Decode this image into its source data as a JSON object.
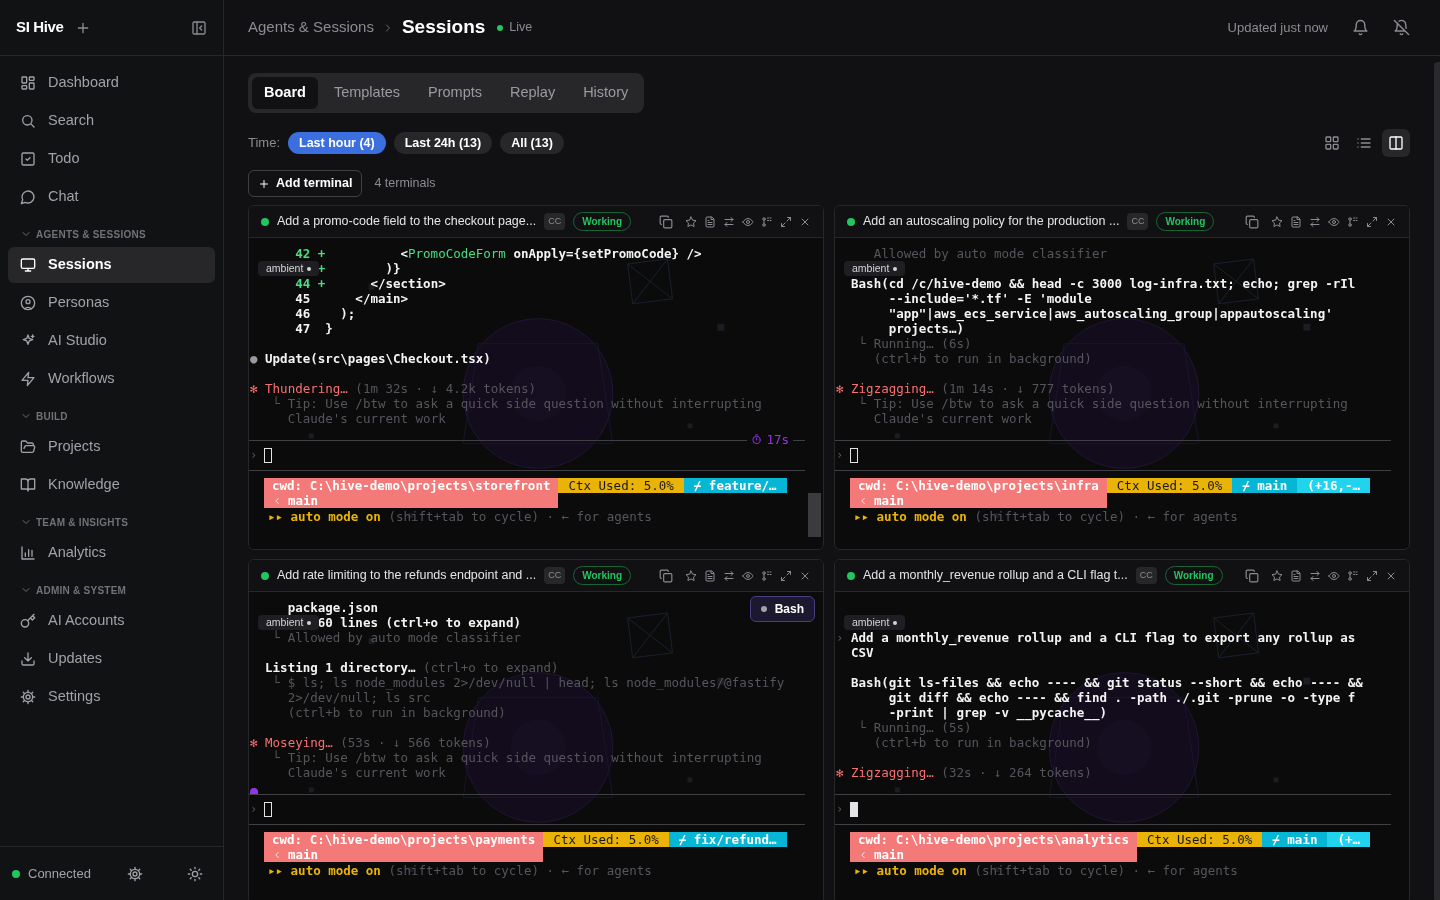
{
  "sidebar": {
    "brand": "SI Hive",
    "groups": [
      {
        "items": [
          {
            "label": "Dashboard",
            "selected": false
          },
          {
            "label": "Search",
            "selected": false
          },
          {
            "label": "Todo",
            "selected": false
          },
          {
            "label": "Chat",
            "selected": false
          }
        ]
      },
      {
        "label": "AGENTS & SESSIONS",
        "expanded": true,
        "items": [
          {
            "label": "Sessions",
            "selected": true
          },
          {
            "label": "Personas",
            "selected": false
          },
          {
            "label": "AI Studio",
            "selected": false
          },
          {
            "label": "Workflows",
            "selected": false
          }
        ]
      },
      {
        "label": "BUILD",
        "expanded": true,
        "items": [
          {
            "label": "Projects",
            "selected": false
          },
          {
            "label": "Knowledge",
            "selected": false
          }
        ]
      },
      {
        "label": "TEAM & INSIGHTS",
        "expanded": true,
        "items": [
          {
            "label": "Analytics",
            "selected": false
          }
        ]
      },
      {
        "label": "ADMIN & SYSTEM",
        "expanded": true,
        "items": [
          {
            "label": "AI Accounts",
            "selected": false
          },
          {
            "label": "Updates",
            "selected": false
          },
          {
            "label": "Settings",
            "selected": false
          }
        ]
      }
    ],
    "footer": {
      "status": "Connected",
      "online": true
    }
  },
  "header": {
    "parent": "Agents & Sessions",
    "title": "Sessions",
    "live": "Live",
    "updated": "Updated just now"
  },
  "tabs": [
    {
      "label": "Board",
      "selected": true
    },
    {
      "label": "Templates",
      "selected": false
    },
    {
      "label": "Prompts",
      "selected": false
    },
    {
      "label": "Replay",
      "selected": false
    },
    {
      "label": "History",
      "selected": false
    }
  ],
  "time_filter": {
    "label": "Time:",
    "options": [
      {
        "label": "Last hour (4)",
        "selected": true
      },
      {
        "label": "Last 24h (13)",
        "selected": false
      },
      {
        "label": "All (13)",
        "selected": false
      }
    ]
  },
  "view_modes": [
    {
      "kind": "grid",
      "selected": false
    },
    {
      "kind": "list",
      "selected": false
    },
    {
      "kind": "columns",
      "selected": true
    }
  ],
  "add_terminal": "Add terminal",
  "terminal_count": "4 terminals",
  "terminals": [
    {
      "title": "Add a promo-code field to the checkout page...",
      "agent": "CC",
      "status": "Working",
      "active": true,
      "ambient": "ambient",
      "prompt": "›",
      "focused": false,
      "scrollbar": true,
      "timer": "17s",
      "lines": [
        {
          "kind": "text",
          "parts": [
            {
              "kind": "add",
              "text": "      42 +          "
            },
            {
              "kind": "bright",
              "text": "<"
            },
            {
              "kind": "tag",
              "text": "PromoCodeForm"
            },
            {
              "kind": "bright",
              "text": " onApply={setPromoCode} />"
            }
          ]
        },
        {
          "kind": "text",
          "parts": [
            {
              "kind": "add",
              "text": "         +        "
            },
            {
              "kind": "bright",
              "text": ")}"
            }
          ]
        },
        {
          "kind": "text",
          "parts": [
            {
              "kind": "add",
              "text": "      44 +      "
            },
            {
              "kind": "bright",
              "text": "</section>"
            }
          ]
        },
        {
          "kind": "text",
          "parts": [
            {
              "kind": "bright",
              "text": "      45      </main>"
            }
          ]
        },
        {
          "kind": "text",
          "parts": [
            {
              "kind": "bright",
              "text": "      46    );"
            }
          ]
        },
        {
          "kind": "text",
          "parts": [
            {
              "kind": "bright",
              "text": "      47  }"
            }
          ]
        },
        {
          "kind": "blank"
        },
        {
          "kind": "text",
          "parts": [
            {
              "kind": "bullet",
              "text": "● "
            },
            {
              "kind": "bright",
              "text": "Update(src\\pages\\Checkout.tsx)"
            }
          ]
        },
        {
          "kind": "blank"
        },
        {
          "kind": "text",
          "parts": [
            {
              "kind": "alert",
              "text": "✻ Thundering…"
            },
            {
              "kind": "dim",
              "text": " (1m 32s · ↓ 4.2k tokens)"
            }
          ]
        },
        {
          "kind": "text",
          "parts": [
            {
              "kind": "dim",
              "text": "   └ Tip: Use /btw to ask a quick side question without interrupting"
            }
          ]
        },
        {
          "kind": "text",
          "parts": [
            {
              "kind": "dim",
              "text": "     Claude's current work"
            }
          ]
        }
      ],
      "status_line": {
        "cwd": "cwd: C:\\hive-demo\\projects\\storefront",
        "cwd_branch": "main",
        "segments": [
          {
            "kind": "ctx",
            "text": "Ctx Used: 5.0%"
          },
          {
            "kind": "branch",
            "text": "⌿ feature/…"
          }
        ]
      },
      "mode": [
        {
          "kind": "accent",
          "text": "▸▸ auto mode on"
        },
        {
          "kind": "dim",
          "text": " (shift+tab to cycle) · ← for agents"
        }
      ]
    },
    {
      "title": "Add an autoscaling policy for the production ...",
      "agent": "CC",
      "status": "Working",
      "active": true,
      "ambient": "ambient",
      "prompt": "›",
      "focused": false,
      "lines": [
        {
          "kind": "text",
          "parts": [
            {
              "kind": "dim",
              "text": "     Allowed by auto mode classifier"
            }
          ]
        },
        {
          "kind": "blank"
        },
        {
          "kind": "text",
          "parts": [
            {
              "kind": "bright",
              "text": "  Bash(cd /c/hive-demo && head -c 3000 log-infra.txt; echo; grep -rIl"
            }
          ]
        },
        {
          "kind": "text",
          "parts": [
            {
              "kind": "bright",
              "text": "       --include='*.tf' -E 'module"
            }
          ]
        },
        {
          "kind": "text",
          "parts": [
            {
              "kind": "bright",
              "text": "       \"app\"|aws_ecs_service|aws_autoscaling_group|appautoscaling'"
            }
          ]
        },
        {
          "kind": "text",
          "parts": [
            {
              "kind": "bright",
              "text": "       projects…)"
            }
          ]
        },
        {
          "kind": "text",
          "parts": [
            {
              "kind": "dim",
              "text": "   └ Running… (6s)"
            }
          ]
        },
        {
          "kind": "text",
          "parts": [
            {
              "kind": "dim",
              "text": "     (ctrl+b to run in background)"
            }
          ]
        },
        {
          "kind": "blank"
        },
        {
          "kind": "text",
          "parts": [
            {
              "kind": "alert",
              "text": "✻ Zigzagging…"
            },
            {
              "kind": "dim",
              "text": " (1m 14s · ↓ 777 tokens)"
            }
          ]
        },
        {
          "kind": "text",
          "parts": [
            {
              "kind": "dim",
              "text": "   └ Tip: Use /btw to ask a quick side question without interrupting"
            }
          ]
        },
        {
          "kind": "text",
          "parts": [
            {
              "kind": "dim",
              "text": "     Claude's current work"
            }
          ]
        }
      ],
      "status_line": {
        "cwd": "cwd: C:\\hive-demo\\projects\\infra",
        "cwd_branch": "main",
        "segments": [
          {
            "kind": "ctx",
            "text": "Ctx Used: 5.0%"
          },
          {
            "kind": "branch",
            "text": "⌿ main"
          },
          {
            "kind": "diff",
            "text": "(+16,-…"
          }
        ]
      },
      "mode": [
        {
          "kind": "accent",
          "text": "▸▸ auto mode on"
        },
        {
          "kind": "dim",
          "text": " (shift+tab to cycle) · ← for agents"
        }
      ]
    },
    {
      "title": "Add rate limiting to the refunds endpoint and ...",
      "agent": "CC",
      "status": "Working",
      "active": true,
      "ambient": "ambient",
      "prompt": "›",
      "focused": false,
      "activity": "Bash",
      "marker": true,
      "lines": [
        {
          "kind": "text",
          "parts": [
            {
              "kind": "bright",
              "text": "     package.json"
            }
          ]
        },
        {
          "kind": "text",
          "parts": [
            {
              "kind": "bright",
              "text": "         60 lines (ctrl+o to expand)"
            }
          ]
        },
        {
          "kind": "text",
          "parts": [
            {
              "kind": "dim",
              "text": "   └ Allowed by auto mode classifier"
            }
          ]
        },
        {
          "kind": "blank"
        },
        {
          "kind": "text",
          "parts": [
            {
              "kind": "bright",
              "text": "  Listing 1 directory…"
            },
            {
              "kind": "dim",
              "text": " (ctrl+o to expand)"
            }
          ]
        },
        {
          "kind": "text",
          "parts": [
            {
              "kind": "dim",
              "text": "   └ $ ls; ls node_modules 2>/dev/null | head; ls node_modules/@fastify"
            }
          ]
        },
        {
          "kind": "text",
          "parts": [
            {
              "kind": "dim",
              "text": "     2>/dev/null; ls src"
            }
          ]
        },
        {
          "kind": "text",
          "parts": [
            {
              "kind": "dim",
              "text": "     (ctrl+b to run in background)"
            }
          ]
        },
        {
          "kind": "blank"
        },
        {
          "kind": "text",
          "parts": [
            {
              "kind": "alert",
              "text": "✻ Moseying…"
            },
            {
              "kind": "dim",
              "text": " (53s · ↓ 566 tokens)"
            }
          ]
        },
        {
          "kind": "text",
          "parts": [
            {
              "kind": "dim",
              "text": "   └ Tip: Use /btw to ask a quick side question without interrupting"
            }
          ]
        },
        {
          "kind": "text",
          "parts": [
            {
              "kind": "dim",
              "text": "     Claude's current work"
            }
          ]
        }
      ],
      "status_line": {
        "cwd": "cwd: C:\\hive-demo\\projects\\payments",
        "cwd_branch": "main",
        "segments": [
          {
            "kind": "ctx",
            "text": "Ctx Used: 5.0%"
          },
          {
            "kind": "branch",
            "text": "⌿ fix/refund…"
          }
        ]
      },
      "mode": [
        {
          "kind": "accent",
          "text": "▸▸ auto mode on"
        },
        {
          "kind": "dim",
          "text": " (shift+tab to cycle) · ← for agents"
        }
      ]
    },
    {
      "title": "Add a monthly_revenue rollup and a CLI flag t...",
      "agent": "CC",
      "status": "Working",
      "active": true,
      "ambient": "ambient",
      "prompt": "›",
      "focused": true,
      "lines": [
        {
          "kind": "blank"
        },
        {
          "kind": "blank"
        },
        {
          "kind": "text",
          "parts": [
            {
              "kind": "dim",
              "text": "› "
            },
            {
              "kind": "bright",
              "text": "Add a monthly_revenue rollup and a CLI flag to export any rollup as"
            }
          ]
        },
        {
          "kind": "text",
          "parts": [
            {
              "kind": "bright",
              "text": "  CSV"
            }
          ]
        },
        {
          "kind": "blank"
        },
        {
          "kind": "text",
          "parts": [
            {
              "kind": "bright",
              "text": "  Bash(git ls-files && echo ---- && git status --short && echo ---- &&"
            }
          ]
        },
        {
          "kind": "text",
          "parts": [
            {
              "kind": "bright",
              "text": "       git diff && echo ---- && find . -path ./.git -prune -o -type f"
            }
          ]
        },
        {
          "kind": "text",
          "parts": [
            {
              "kind": "bright",
              "text": "       -print | grep -v __pycache__)"
            }
          ]
        },
        {
          "kind": "text",
          "parts": [
            {
              "kind": "dim",
              "text": "   └ Running… (5s)"
            }
          ]
        },
        {
          "kind": "text",
          "parts": [
            {
              "kind": "dim",
              "text": "     (ctrl+b to run in background)"
            }
          ]
        },
        {
          "kind": "blank"
        },
        {
          "kind": "text",
          "parts": [
            {
              "kind": "alert",
              "text": "✻ Zigzagging…"
            },
            {
              "kind": "dim",
              "text": " (32s · ↓ 264 tokens)"
            }
          ]
        }
      ],
      "status_line": {
        "cwd": "cwd: C:\\hive-demo\\projects\\analytics",
        "cwd_branch": "main",
        "segments": [
          {
            "kind": "ctx",
            "text": "Ctx Used: 5.0%"
          },
          {
            "kind": "branch",
            "text": "⌿ main"
          },
          {
            "kind": "diff",
            "text": "(+…"
          }
        ]
      },
      "mode": [
        {
          "kind": "accent",
          "text": "▸▸ auto mode on"
        },
        {
          "kind": "dim",
          "text": " (shift+tab to cycle) · ← for agents"
        }
      ]
    }
  ]
}
